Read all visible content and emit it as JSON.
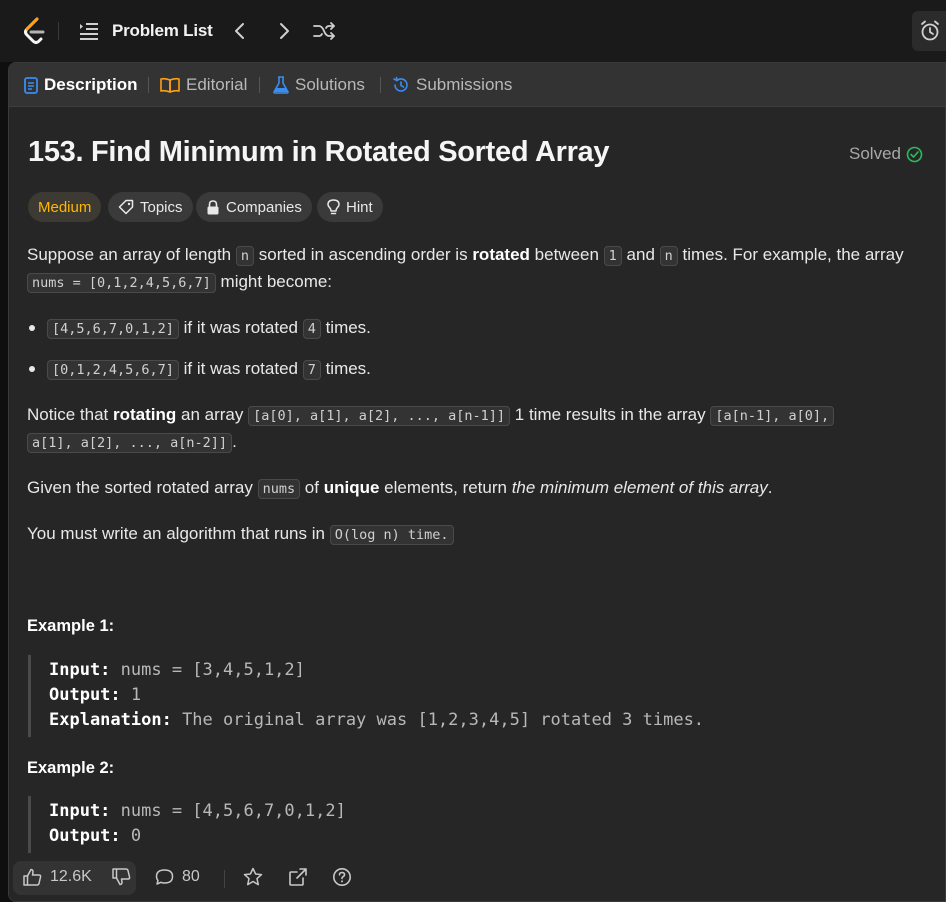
{
  "topbar": {
    "title": "Problem List"
  },
  "tabs": [
    {
      "label": "Description"
    },
    {
      "label": "Editorial"
    },
    {
      "label": "Solutions"
    },
    {
      "label": "Submissions"
    }
  ],
  "problem": {
    "title": "153. Find Minimum in Rotated Sorted Array",
    "status": "Solved",
    "difficulty": "Medium",
    "tags": [
      "Topics",
      "Companies",
      "Hint"
    ]
  },
  "desc": {
    "l1_a": "Suppose an array of length ",
    "l1_code1": "n",
    "l1_b": " sorted in ascending order is ",
    "l1_bold": "rotated",
    "l1_c": " between ",
    "l1_code2": "1",
    "l1_d": " and ",
    "l1_code3": "n",
    "l1_e": " times. For example, the array",
    "l2_code": "nums = [0,1,2,4,5,6,7]",
    "l2_a": " might become:",
    "b1_code": "[4,5,6,7,0,1,2]",
    "b1_a": " if it was rotated ",
    "b1_code2": "4",
    "b1_b": " times.",
    "b2_code": "[0,1,2,4,5,6,7]",
    "b2_a": " if it was rotated ",
    "b2_code2": "7",
    "b2_b": " times.",
    "n1_a": "Notice that ",
    "n1_bold": "rotating",
    "n1_b": " an array ",
    "n1_code": "[a[0], a[1], a[2], ..., a[n-1]]",
    "n1_c": " 1 time results in the array ",
    "n1_code2": "[a[n-1], a[0],",
    "n2_code": "a[1], a[2], ..., a[n-2]]",
    "n2_a": ".",
    "g_a": "Given the sorted rotated array ",
    "g_code": "nums",
    "g_b": " of ",
    "g_bold": "unique",
    "g_c": " elements, return ",
    "g_italic": "the minimum element of this array",
    "g_d": ".",
    "m_a": "You must write an algorithm that runs in ",
    "m_code": "O(log n) time."
  },
  "examples": [
    {
      "heading": "Example 1:",
      "input_label": "Input:",
      "input": " nums = [3,4,5,1,2]",
      "output_label": "Output:",
      "output": " 1",
      "expl_label": "Explanation:",
      "expl": " The original array was [1,2,3,4,5] rotated 3 times."
    },
    {
      "heading": "Example 2:",
      "input_label": "Input:",
      "input": " nums = [4,5,6,7,0,1,2]",
      "output_label": "Output:",
      "output": " 0"
    }
  ],
  "bottom": {
    "likes": "12.6K",
    "comments": "80"
  },
  "colors": {
    "accent_blue": "#3b8cf0",
    "medium": "#ffb800",
    "solved_green": "#2cbb5d",
    "editorial_orange": "#ffa116"
  }
}
